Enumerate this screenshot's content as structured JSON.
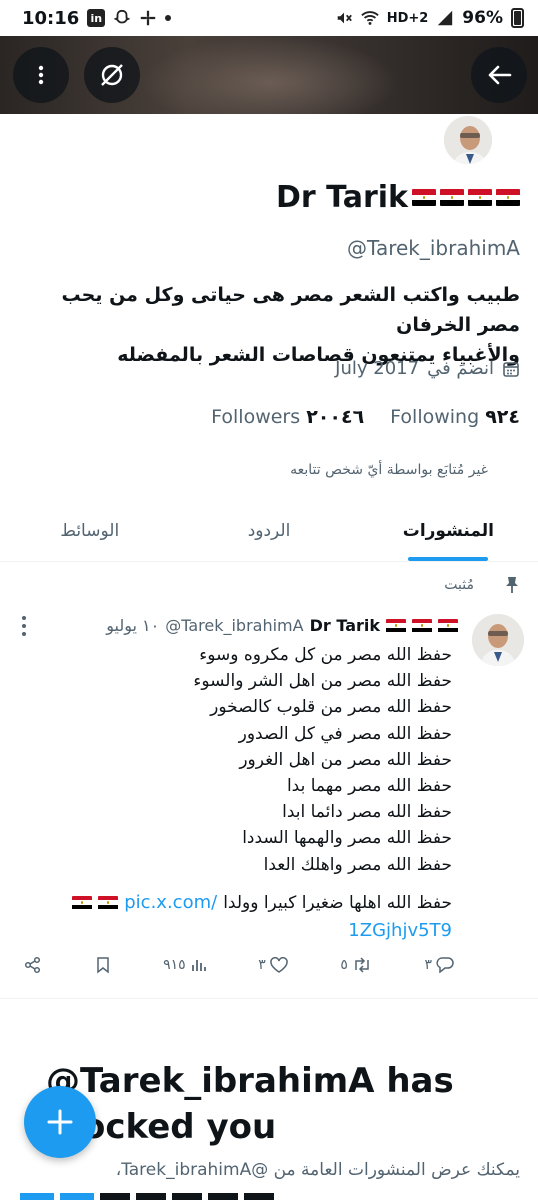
{
  "status_bar": {
    "time": "10:16",
    "linkedin_badge": "in",
    "network_label": "HD+2",
    "battery": "96%"
  },
  "profile": {
    "display_name": "Dr Tarik",
    "handle": "@Tarek_ibrahimA",
    "bio_line1": "طبيب واكتب الشعر مصر هى حياتى وكل من يحب مصر الخرفان",
    "bio_line2": "والأغبياء يمتنعون قصاصات الشعر بالمفضله",
    "joined_label": "انضمَ في",
    "joined_date": "July 2017",
    "following_count": "٩٢٤",
    "following_label": "Following",
    "followers_count": "٢٠٠٤٦",
    "followers_label": "Followers",
    "not_followed_note": "غير مُتابَع بواسطة أيّ شخص تتابعه"
  },
  "tabs": [
    {
      "label": "المنشورات",
      "active": true
    },
    {
      "label": "الردود",
      "active": false
    },
    {
      "label": "الوسائط",
      "active": false
    }
  ],
  "post": {
    "pinned_label": "مُثبت",
    "author_name": "Dr Tarik",
    "author_handle": "@Tarek_ibrahimA",
    "date": "١٠ يوليو",
    "lines": [
      "حفظ الله مصر من كل مكروه وسوء",
      "حفظ الله مصر من اهل الشر والسوء",
      "حفظ الله مصر من قلوب كالصخور",
      "حفظ الله مصر في كل الصدور",
      "حفظ الله مصر من اهل الغرور",
      "حفظ الله مصر مهما بدا",
      "حفظ الله مصر دائما ابدا",
      "حفظ الله مصر والهمها السددا",
      "حفظ الله مصر واهلك العدا"
    ],
    "last_line": "حفظ الله اهلها ضغيرا كبيرا وولدا",
    "link_part1": "pic.x.com/",
    "link_part2": "1ZGjhjv5T9",
    "replies": "٣",
    "reposts": "٥",
    "likes": "٣",
    "views": "٩١٥"
  },
  "blocked": {
    "title": "@Tarek_ibrahimA has blocked you",
    "subtitle": "يمكنك عرض المنشورات العامة من @Tarek_ibrahimA،"
  },
  "colors": {
    "accent": "#1d9bf0",
    "text": "#0f1419",
    "muted": "#536471"
  },
  "icons": [
    "more-vertical-icon",
    "grok-icon",
    "back-arrow-icon",
    "calendar-icon",
    "pin-icon",
    "reply-icon",
    "repost-icon",
    "like-icon",
    "views-icon",
    "bookmark-icon",
    "share-icon",
    "compose-plus-icon"
  ]
}
